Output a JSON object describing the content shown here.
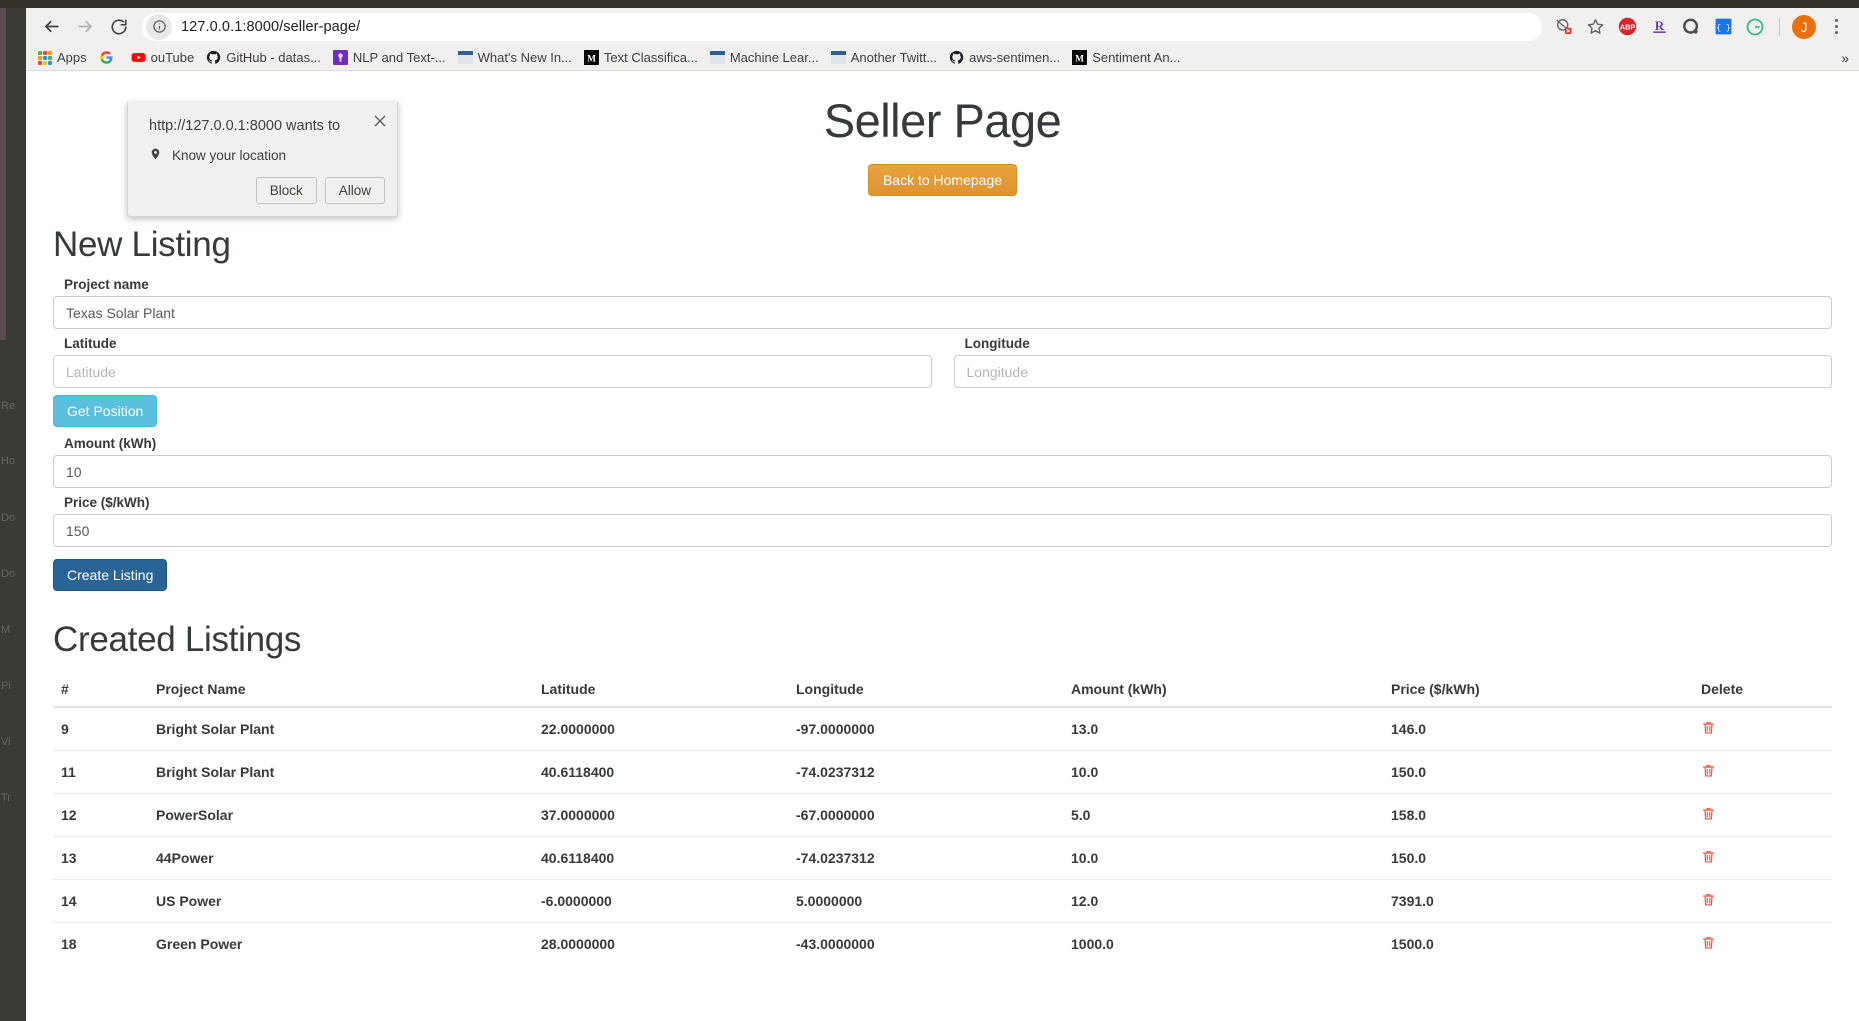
{
  "browser": {
    "url": "127.0.0.1:8000/seller-page/",
    "nav": {
      "back": "back-arrow",
      "forward": "forward-arrow",
      "reload": "reload"
    },
    "toolbar_icons": [
      "geolocation-blocked-icon",
      "bookmark-star-icon",
      "adblock-plus-icon",
      "rstudio-icon",
      "quora-icon",
      "json-viewer-icon",
      "grammarly-icon"
    ],
    "profile_initial": "J",
    "bookmarks": [
      {
        "label": "Apps",
        "icon": "apps-grid-icon"
      },
      {
        "label": "",
        "icon": "google-icon"
      },
      {
        "label": "ouTube",
        "icon": "youtube-icon"
      },
      {
        "label": "GitHub - datas...",
        "icon": "github-icon"
      },
      {
        "label": "NLP and Text-...",
        "icon": "medium-purple-icon"
      },
      {
        "label": "What's New In...",
        "icon": "doc-icon"
      },
      {
        "label": "Text Classifica...",
        "icon": "medium-m-icon"
      },
      {
        "label": "Machine Lear...",
        "icon": "doc-icon"
      },
      {
        "label": "Another Twitt...",
        "icon": "doc-icon"
      },
      {
        "label": "aws-sentimen...",
        "icon": "github-icon"
      },
      {
        "label": "Sentiment An...",
        "icon": "medium-m-icon"
      }
    ],
    "bookmarks_overflow": "»"
  },
  "permission_dialog": {
    "title": "http://127.0.0.1:8000 wants to",
    "permission": "Know your location",
    "permission_icon": "location-pin-icon",
    "block_label": "Block",
    "allow_label": "Allow",
    "close_icon": "close-icon"
  },
  "page": {
    "title": "Seller Page",
    "home_button": "Back to Homepage",
    "new_listing_heading": "New Listing",
    "created_listings_heading": "Created Listings",
    "form": {
      "project_name_label": "Project name",
      "project_name_value": "Texas Solar Plant",
      "project_name_placeholder": "Project name",
      "latitude_label": "Latitude",
      "latitude_value": "",
      "latitude_placeholder": "Latitude",
      "longitude_label": "Longitude",
      "longitude_value": "",
      "longitude_placeholder": "Longitude",
      "get_position_label": "Get Position",
      "amount_label": "Amount (kWh)",
      "amount_value": "10",
      "amount_placeholder": "Amount (kWh)",
      "price_label": "Price ($/kWh)",
      "price_value": "150",
      "price_placeholder": "Price ($/kWh)",
      "create_listing_label": "Create Listing"
    },
    "table": {
      "columns": [
        "#",
        "Project Name",
        "Latitude",
        "Longitude",
        "Amount (kWh)",
        "Price ($/kWh)",
        "Delete"
      ],
      "rows": [
        {
          "id": "9",
          "name": "Bright Solar Plant",
          "lat": "22.0000000",
          "lon": "-97.0000000",
          "amount": "13.0",
          "price": "146.0",
          "delete_icon": "trash-icon"
        },
        {
          "id": "11",
          "name": "Bright Solar Plant",
          "lat": "40.6118400",
          "lon": "-74.0237312",
          "amount": "10.0",
          "price": "150.0",
          "delete_icon": "trash-icon"
        },
        {
          "id": "12",
          "name": "PowerSolar",
          "lat": "37.0000000",
          "lon": "-67.0000000",
          "amount": "5.0",
          "price": "158.0",
          "delete_icon": "trash-icon"
        },
        {
          "id": "13",
          "name": "44Power",
          "lat": "40.6118400",
          "lon": "-74.0237312",
          "amount": "10.0",
          "price": "150.0",
          "delete_icon": "trash-icon"
        },
        {
          "id": "14",
          "name": "US Power",
          "lat": "-6.0000000",
          "lon": "5.0000000",
          "amount": "12.0",
          "price": "7391.0",
          "delete_icon": "trash-icon"
        },
        {
          "id": "18",
          "name": "Green Power",
          "lat": "28.0000000",
          "lon": "-43.0000000",
          "amount": "1000.0",
          "price": "1500.0",
          "delete_icon": "trash-icon"
        }
      ]
    }
  },
  "colors": {
    "warning": "#e0a03a",
    "info": "#5bc0de",
    "primary": "#2a6496",
    "danger": "#fc4f3b",
    "text": "#373a3c"
  }
}
